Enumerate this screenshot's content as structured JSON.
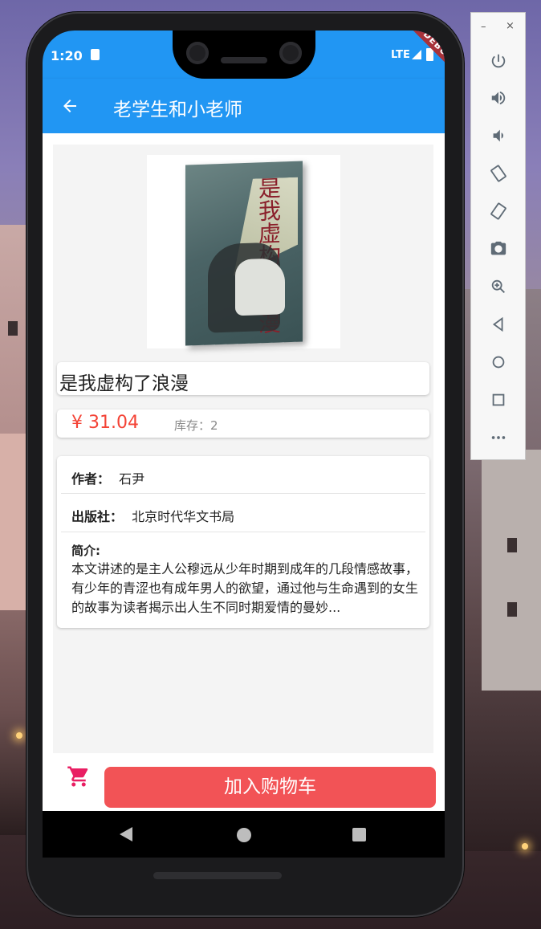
{
  "status_bar": {
    "time": "1:20",
    "network": "LTE",
    "debug_banner": "DEBUG"
  },
  "app_bar": {
    "title": "老学生和小老师",
    "back_icon": "arrow-left-icon"
  },
  "book": {
    "cover_title_art": "是我虚构了浪漫",
    "name": "是我虚构了浪漫",
    "price": "¥ 31.04",
    "stock": "库存：2",
    "author_label": "作者：",
    "author": "石尹",
    "publisher_label": "出版社：",
    "publisher": "北京时代华文书局",
    "intro_label": "简介:",
    "intro": "本文讲述的是主人公穆远从少年时期到成年的几段情感故事，有少年的青涩也有成年男人的欲望，通过他与生命遇到的女生的故事为读者揭示出人生不同时期爱情的曼妙..."
  },
  "bottom_bar": {
    "cart_icon": "shopping-cart-icon",
    "add_to_cart": "加入购物车"
  },
  "colors": {
    "primary": "#2196f3",
    "price": "#f44336",
    "add_to_cart_bg": "#f25356",
    "cart_icon": "#e91e63"
  },
  "emulator_panel": {
    "minimize": "–",
    "close": "×",
    "buttons": [
      "power-icon",
      "volume-up-icon",
      "volume-down-icon",
      "rotate-left-icon",
      "rotate-right-icon",
      "camera-icon",
      "zoom-icon",
      "back-icon",
      "home-icon",
      "overview-icon",
      "more-icon"
    ]
  }
}
